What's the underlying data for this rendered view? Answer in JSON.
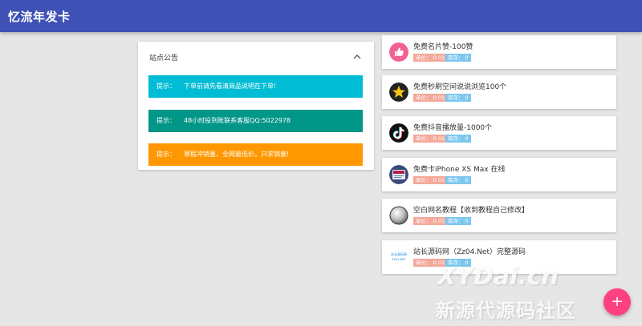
{
  "header": {
    "title": "忆流年发卡"
  },
  "notice": {
    "title": "站点公告",
    "items": [
      {
        "label": "提示：",
        "text": "下单前请先看清商品说明在下单!"
      },
      {
        "label": "提示：",
        "text": "48小时投到账联系客服QQ:5022978"
      },
      {
        "label": "提示：",
        "text": "寒假冲销量，全网最低价，只求销量!"
      }
    ]
  },
  "product_labels": {
    "price": "单价：",
    "stock": "库存："
  },
  "products": [
    {
      "name": "免费名片赞-100赞",
      "price": "0.01元",
      "stock": "0",
      "icon": "thumbs-up-icon"
    },
    {
      "name": "免费秒刷空间说说浏览100个",
      "price": "0.01元",
      "stock": "0",
      "icon": "star-icon"
    },
    {
      "name": "免费抖音播放量-1000个",
      "price": "0.01元",
      "stock": "0",
      "icon": "tiktok-icon"
    },
    {
      "name": "免费卡iPhone XS Max 在线",
      "price": "0.01元",
      "stock": "0",
      "icon": "phone-icon"
    },
    {
      "name": "空白网名教程【收到教程自己修改】",
      "price": "0.01元",
      "stock": "0",
      "icon": "blank-circle-icon"
    },
    {
      "name": "站长源码网（Zz04.Net）完整源码",
      "price": "0.01元",
      "stock": "0",
      "icon": "site-logo-icon"
    }
  ],
  "logo_text": {
    "line1": "站长源码网",
    "line2": "ZZ04.NET"
  },
  "watermark": {
    "line1": "XYDai.cn",
    "line2": "新源代源码社区"
  },
  "fab": {
    "symbol": "+"
  },
  "colors": {
    "primary": "#3f51b5",
    "accent": "#ff4081",
    "cyan": "#00bcd4",
    "teal": "#009688",
    "orange": "#ff9800",
    "price_badge": "#f4a99a",
    "stock_badge": "#7cc7ee"
  }
}
